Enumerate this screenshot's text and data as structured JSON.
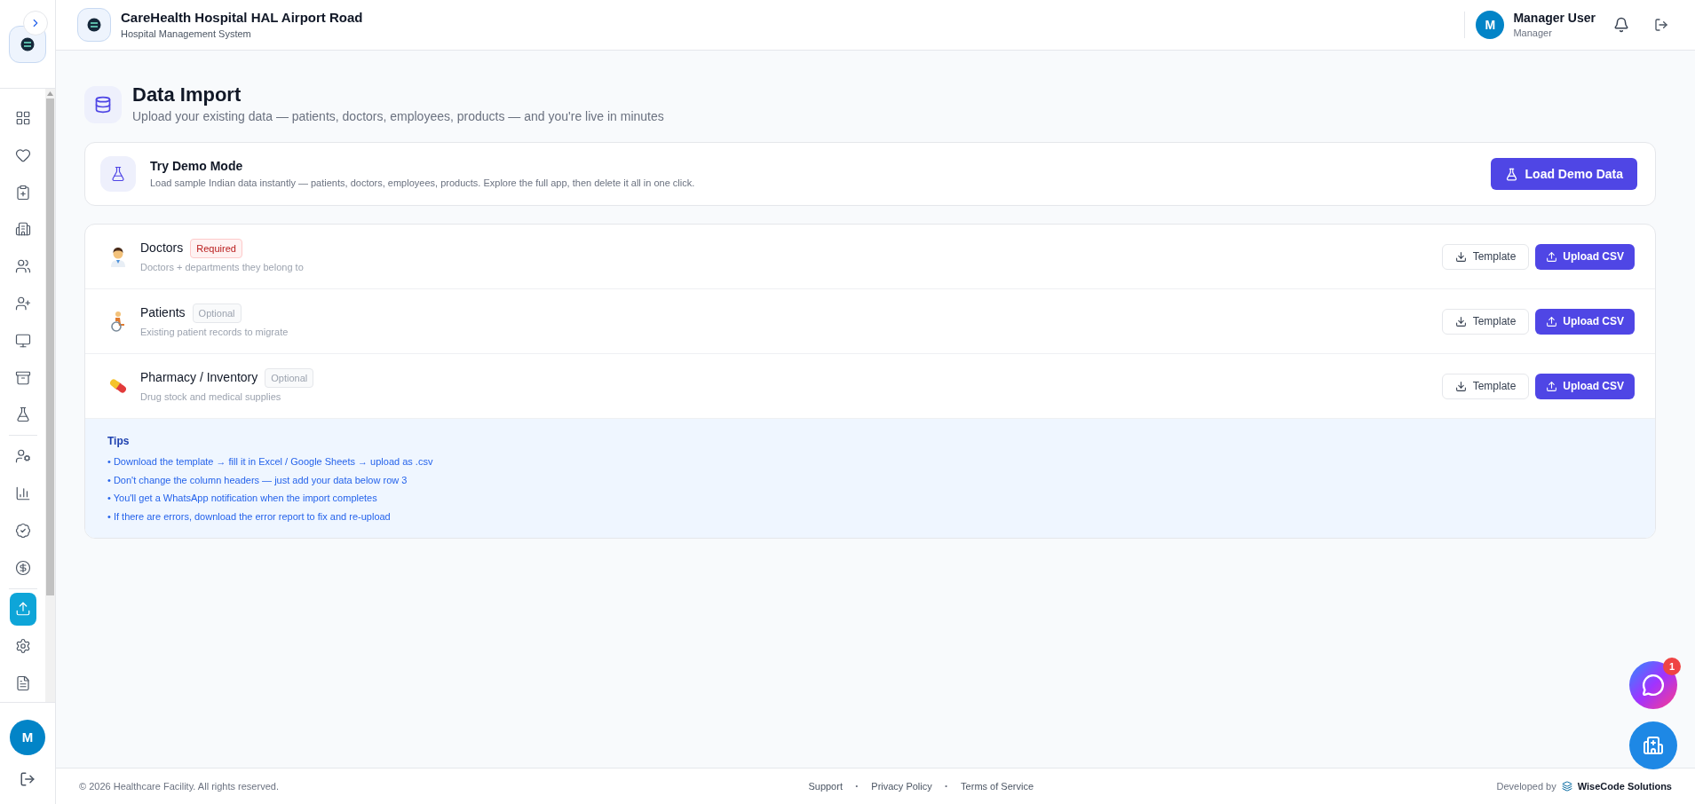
{
  "header": {
    "title": "CareHealth Hospital HAL Airport Road",
    "subtitle": "Hospital Management System",
    "user": {
      "initial": "M",
      "name": "Manager User",
      "role": "Manager"
    }
  },
  "sidebar": {
    "items": [
      {
        "selected": false
      },
      {
        "selected": false
      },
      {
        "selected": false
      },
      {
        "selected": false
      },
      {
        "selected": false
      },
      {
        "selected": false
      },
      {
        "selected": false
      },
      {
        "selected": false
      },
      {
        "selected": false
      },
      {
        "selected": false
      },
      {
        "selected": false
      },
      {
        "selected": false
      },
      {
        "selected": false
      },
      {
        "selected": true
      },
      {
        "selected": false
      },
      {
        "selected": false
      }
    ],
    "user_initial": "M"
  },
  "page": {
    "title": "Data Import",
    "subtitle": "Upload your existing data — patients, doctors, employees, products — and you're live in minutes"
  },
  "demo": {
    "title": "Try Demo Mode",
    "description": "Load sample Indian data instantly — patients, doctors, employees, products. Explore the full app, then delete it all in one click.",
    "button": "Load Demo Data"
  },
  "imports": [
    {
      "kind": "doctor",
      "name": "Doctors",
      "badge": "Required",
      "required": true,
      "description": "Doctors + departments they belong to",
      "template": "Template",
      "upload": "Upload CSV"
    },
    {
      "kind": "patient",
      "name": "Patients",
      "badge": "Optional",
      "required": false,
      "description": "Existing patient records to migrate",
      "template": "Template",
      "upload": "Upload CSV"
    },
    {
      "kind": "pharmacy",
      "name": "Pharmacy / Inventory",
      "badge": "Optional",
      "required": false,
      "description": "Drug stock and medical supplies",
      "template": "Template",
      "upload": "Upload CSV"
    }
  ],
  "tips": {
    "title": "Tips",
    "items": [
      "• Download the template → fill it in Excel / Google Sheets → upload as .csv",
      "• Don't change the column headers — just add your data below row 3",
      "• You'll get a WhatsApp notification when the import completes",
      "• If there are errors, download the error report to fix and re-upload"
    ]
  },
  "footer": {
    "copyright": "© 2026 Healthcare Facility. All rights reserved.",
    "links": [
      "Support",
      "Privacy Policy",
      "Terms of Service"
    ],
    "separator": "·",
    "developed_by": "Developed by",
    "brand": "WiseCode Solutions"
  },
  "chat": {
    "badge": "1"
  }
}
